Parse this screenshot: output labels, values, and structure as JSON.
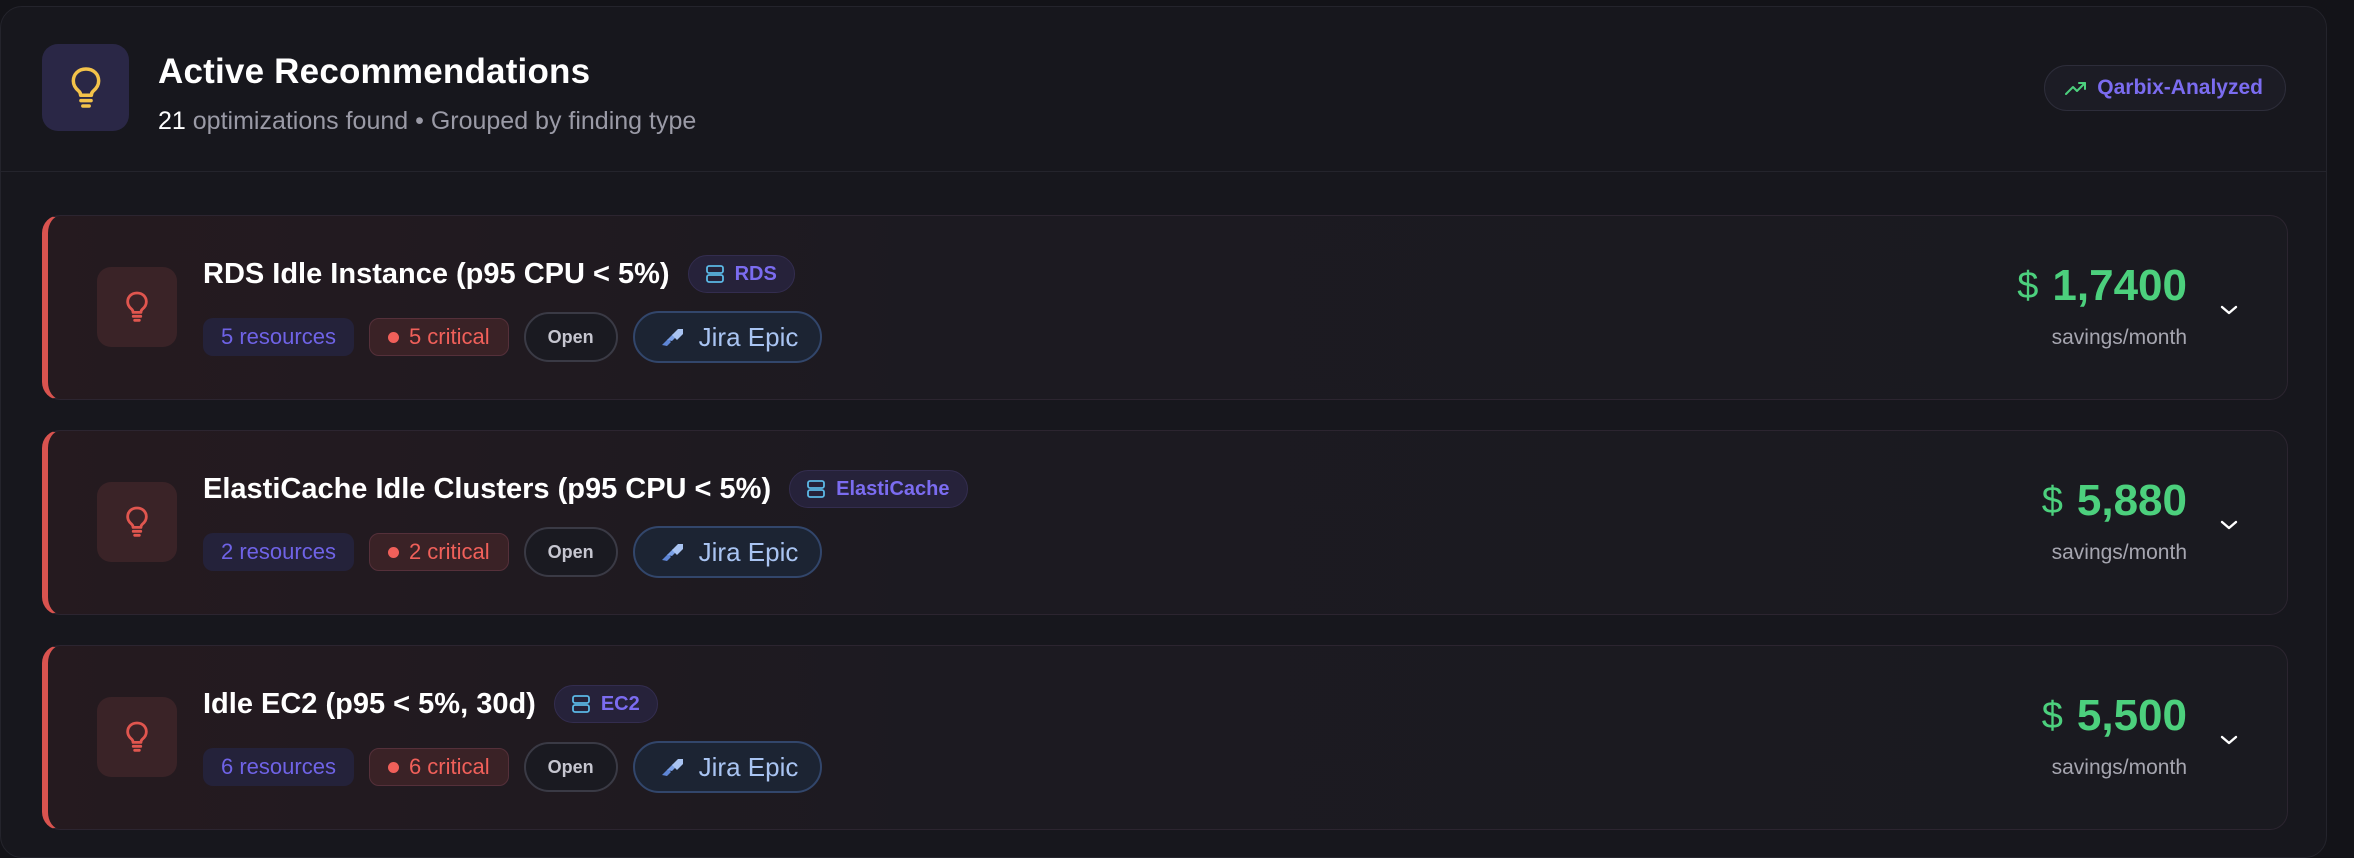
{
  "header": {
    "title": "Active Recommendations",
    "count": "21",
    "subtitle_rest": "optimizations found • Grouped by finding type",
    "badge_label": "Qarbix-Analyzed",
    "icon": "lightbulb-icon",
    "badge_icon": "trending-up-icon"
  },
  "colors": {
    "critical": "#d9534f",
    "savings": "#4cd07d",
    "accent": "#7b6cf0",
    "jira": "#a9c4f2"
  },
  "recommendations": [
    {
      "title": "RDS Idle Instance (p95 CPU < 5%)",
      "service": "RDS",
      "resources": "5 resources",
      "critical": "5 critical",
      "status": "Open",
      "jira_label": "Jira Epic",
      "savings_amount": "1,7400",
      "savings_label": "savings/month"
    },
    {
      "title": "ElastiCache Idle Clusters (p95 CPU < 5%)",
      "service": "ElastiCache",
      "resources": "2 resources",
      "critical": "2 critical",
      "status": "Open",
      "jira_label": "Jira Epic",
      "savings_amount": "5,880",
      "savings_label": "savings/month"
    },
    {
      "title": "Idle EC2 (p95 < 5%, 30d)",
      "service": "EC2",
      "resources": "6 resources",
      "critical": "6 critical",
      "status": "Open",
      "jira_label": "Jira Epic",
      "savings_amount": "5,500",
      "savings_label": "savings/month"
    }
  ]
}
